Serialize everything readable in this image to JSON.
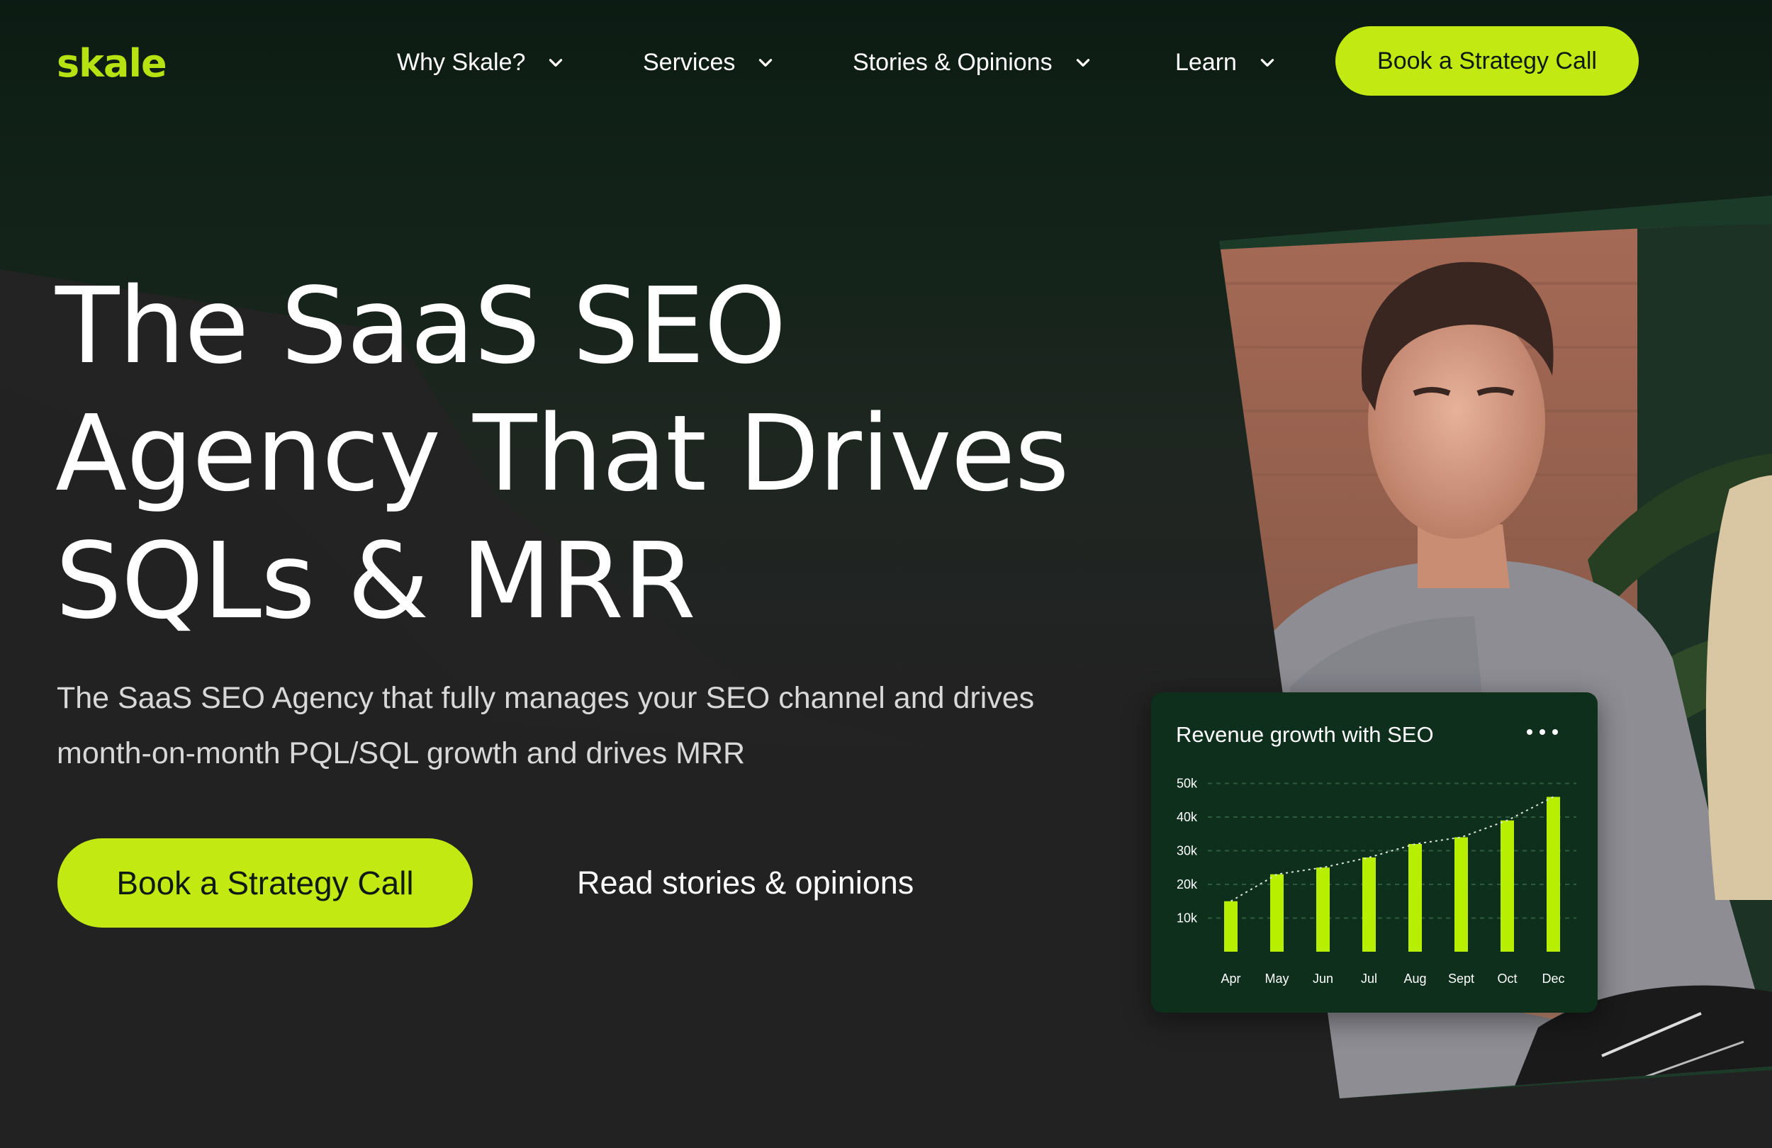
{
  "nav": {
    "logo": "skale",
    "items": [
      {
        "label": "Why Skale?",
        "icon": "chevron-down-icon"
      },
      {
        "label": "Services",
        "icon": "chevron-down-icon"
      },
      {
        "label": "Stories & Opinions",
        "icon": "chevron-down-icon"
      },
      {
        "label": "Learn",
        "icon": "chevron-down-icon"
      }
    ],
    "cta_label": "Book a Strategy Call"
  },
  "hero": {
    "title_lines": [
      "The SaaS SEO",
      "Agency That Drives",
      "SQLs & MRR"
    ],
    "subtitle_lines": [
      "The SaaS SEO Agency that fully manages your SEO channel and drives",
      "month-on-month PQL/SQL growth and drives MRR"
    ],
    "cta_label": "Book a Strategy Call",
    "link_label": "Read stories & opinions"
  },
  "colors": {
    "accent": "#c2ea12",
    "bar": "#b8ee00",
    "card_bg": "#0d2f1c",
    "page_bg": "#222222"
  },
  "chart_data": {
    "type": "bar",
    "title": "Revenue growth with SEO",
    "menu_icon": "more-dots-icon",
    "categories": [
      "Apr",
      "May",
      "Jun",
      "Jul",
      "Aug",
      "Sept",
      "Oct",
      "Dec"
    ],
    "values": [
      15,
      23,
      25,
      28,
      32,
      34,
      39,
      46
    ],
    "trend_line": true,
    "yticks": [
      "50k",
      "40k",
      "30k",
      "20k",
      "10k"
    ],
    "ytick_values": [
      50,
      40,
      30,
      20,
      10
    ],
    "ylim": [
      0,
      56
    ],
    "grid": true
  }
}
